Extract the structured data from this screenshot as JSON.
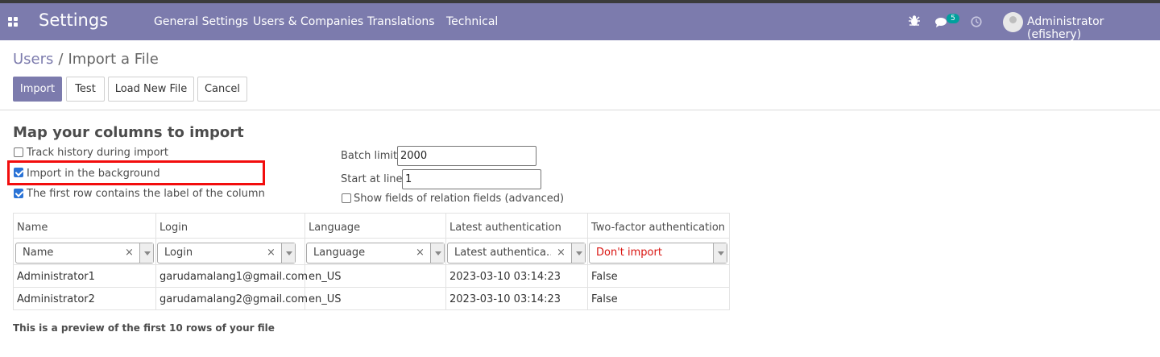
{
  "navbar": {
    "app_title": "Settings",
    "menu": [
      "General Settings",
      "Users & Companies",
      "Translations",
      "Technical"
    ],
    "chat_count": "5",
    "user_name": "Administrator (efishery)",
    "icons": [
      "apps-icon",
      "bug-icon",
      "chat-icon",
      "clock-icon"
    ]
  },
  "breadcrumb": {
    "parent": "Users",
    "separator": "/",
    "current": "Import a File"
  },
  "buttons": {
    "import": "Import",
    "test": "Test",
    "load_new_file": "Load New File",
    "cancel": "Cancel"
  },
  "options": {
    "title": "Map your columns to import",
    "track_history": {
      "label": "Track history during import",
      "checked": false
    },
    "import_background": {
      "label": "Import in the background",
      "checked": true
    },
    "first_row_label": {
      "label": "The first row contains the label of the column",
      "checked": true
    },
    "batch_limit_label": "Batch limit",
    "batch_limit_value": "2000",
    "start_line_label": "Start at line",
    "start_line_value": "1",
    "show_relation_fields": {
      "label": "Show fields of relation fields (advanced)",
      "checked": false
    }
  },
  "table": {
    "headers": [
      "Name",
      "Login",
      "Language",
      "Latest authentication",
      "Two-factor authentication"
    ],
    "mapping": [
      "Name",
      "Login",
      "Language",
      "Latest authentica…",
      "Don't import"
    ],
    "rows": [
      [
        "Administrator1",
        "garudamalang1@gmail.com",
        "en_US",
        "2023-03-10 03:14:23",
        "False"
      ],
      [
        "Administrator2",
        "garudamalang2@gmail.com",
        "en_US",
        "2023-03-10 03:14:23",
        "False"
      ]
    ]
  },
  "preview_note": "This is a preview of the first 10 rows of your file",
  "colors": {
    "brand": "#7c7bad",
    "highlight": "#f20d0d",
    "dont_import": "#d9130f"
  }
}
